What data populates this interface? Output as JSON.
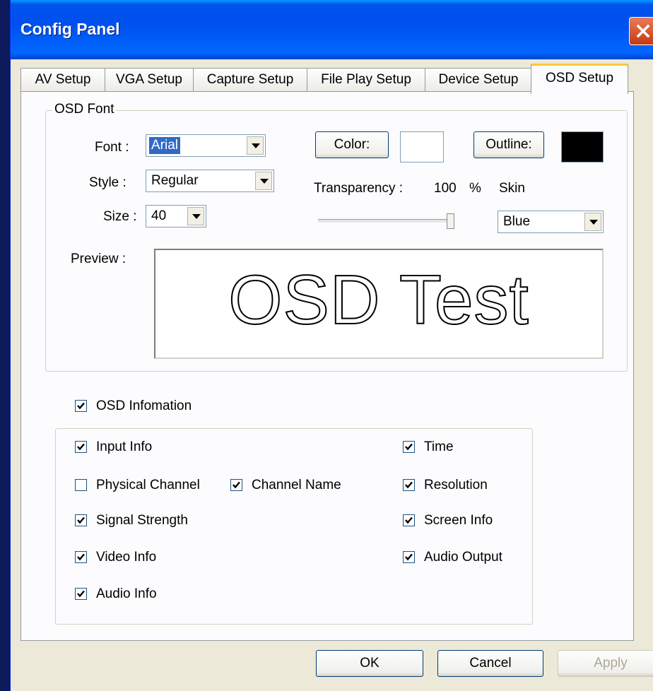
{
  "window": {
    "title": "Config Panel"
  },
  "tabs": [
    {
      "label": "AV Setup",
      "active": false
    },
    {
      "label": "VGA Setup",
      "active": false
    },
    {
      "label": "Capture Setup",
      "active": false
    },
    {
      "label": "File Play Setup",
      "active": false
    },
    {
      "label": "Device Setup",
      "active": false
    },
    {
      "label": "OSD Setup",
      "active": true
    }
  ],
  "osd_font": {
    "group_title": "OSD Font",
    "font_label": "Font :",
    "font_value": "Arial",
    "style_label": "Style :",
    "style_value": "Regular",
    "size_label": "Size :",
    "size_value": "40",
    "color_button": "Color:",
    "color_value": "#ffffff",
    "outline_button": "Outline:",
    "outline_value": "#000000",
    "transparency_label": "Transparency :",
    "transparency_value": "100",
    "transparency_unit": "%",
    "skin_label": "Skin",
    "skin_value": "Blue",
    "preview_label": "Preview :",
    "preview_text": "OSD Test"
  },
  "osd_information": {
    "label": "OSD Infomation",
    "checked": true
  },
  "options": [
    {
      "label": "Input Info",
      "checked": true
    },
    {
      "label": "Physical Channel",
      "checked": false
    },
    {
      "label": "Channel Name",
      "checked": true
    },
    {
      "label": "Signal Strength",
      "checked": true
    },
    {
      "label": "Video Info",
      "checked": true
    },
    {
      "label": "Audio Info",
      "checked": true
    },
    {
      "label": "Time",
      "checked": true
    },
    {
      "label": "Resolution",
      "checked": true
    },
    {
      "label": "Screen Info",
      "checked": true
    },
    {
      "label": "Audio Output",
      "checked": true
    }
  ],
  "footer": {
    "ok": "OK",
    "cancel": "Cancel",
    "apply": "Apply"
  },
  "colors": {
    "title_bar": "#0054e3",
    "active_tab_accent": "#ffc83c",
    "selection": "#316ac5"
  }
}
